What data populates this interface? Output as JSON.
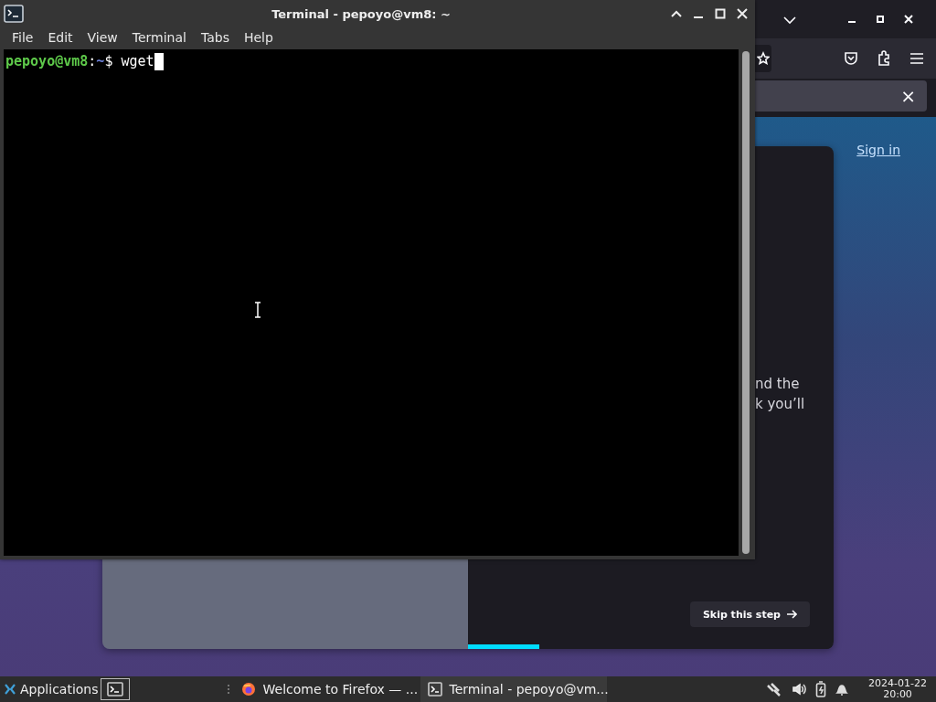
{
  "browser": {
    "notification_close": "×",
    "sign_in": "Sign in",
    "partial_text": [
      "nd the",
      "k you’ll"
    ],
    "skip_button": "Skip this step",
    "progress": {
      "level": 0.195
    }
  },
  "terminal": {
    "title": "Terminal - pepoyo@vm8: ~",
    "menu": [
      "File",
      "Edit",
      "View",
      "Terminal",
      "Tabs",
      "Help"
    ],
    "prompt": {
      "user_host": "pepoyo@vm8",
      "separator": ":",
      "path": "~",
      "symbol": "$",
      "command": "wget"
    }
  },
  "taskbar": {
    "apps_label": "Applications",
    "tasks": [
      {
        "kind": "firefox",
        "label": "Welcome to Firefox — ...",
        "selected": false
      },
      {
        "kind": "terminal",
        "label": "Terminal - pepoyo@vm...",
        "selected": true
      }
    ],
    "clock": {
      "date": "2024-01-22",
      "time": "20:00"
    }
  }
}
